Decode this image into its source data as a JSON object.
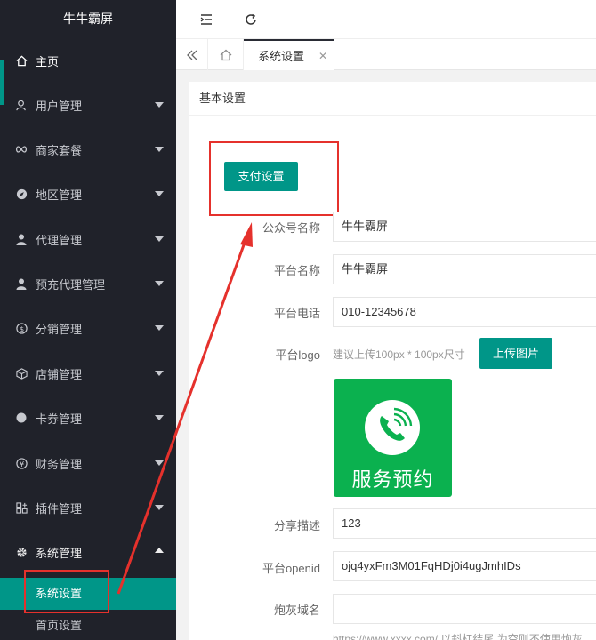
{
  "app": {
    "title": "牛牛霸屏"
  },
  "sidebar": {
    "items": [
      {
        "label": "主页",
        "icon": "home-icon"
      },
      {
        "label": "用户管理",
        "icon": "user-group-icon"
      },
      {
        "label": "商家套餐",
        "icon": "infinity-icon"
      },
      {
        "label": "地区管理",
        "icon": "compass-icon"
      },
      {
        "label": "代理管理",
        "icon": "person-icon"
      },
      {
        "label": "预充代理管理",
        "icon": "person-icon"
      },
      {
        "label": "分销管理",
        "icon": "dollar-icon"
      },
      {
        "label": "店铺管理",
        "icon": "cube-icon"
      },
      {
        "label": "卡券管理",
        "icon": "circle-icon"
      },
      {
        "label": "财务管理",
        "icon": "yen-icon"
      },
      {
        "label": "插件管理",
        "icon": "apps-icon"
      },
      {
        "label": "系统管理",
        "icon": "gear-icon"
      }
    ],
    "submenu": [
      {
        "label": "系统设置"
      },
      {
        "label": "首页设置"
      }
    ]
  },
  "tabs": {
    "active_label": "系统设置"
  },
  "card": {
    "header": "基本设置"
  },
  "pay_button": "支付设置",
  "form": {
    "account_name_label": "公众号名称",
    "account_name_value": "牛牛霸屏",
    "platform_name_label": "平台名称",
    "platform_name_value": "牛牛霸屏",
    "phone_label": "平台电话",
    "phone_value": "010-12345678",
    "logo_label": "平台logo",
    "logo_hint": "建议上传100px * 100px尺寸",
    "upload_button": "上传图片",
    "logo_text": "服务预约",
    "share_label": "分享描述",
    "share_value": "123",
    "openid_label": "平台openid",
    "openid_value": "ojq4yxFm3M01FqHDj0i4ugJmhIDs",
    "domain_label": "炮灰域名",
    "domain_value": "",
    "domain_hint": "https://www.xxxx.com/ 以斜杠结尾 为空则不使用炮灰"
  },
  "colors": {
    "accent": "#009688",
    "sidebar_bg": "#20222a",
    "annotation": "#e5312c",
    "logo_bg": "#0bb14f"
  }
}
